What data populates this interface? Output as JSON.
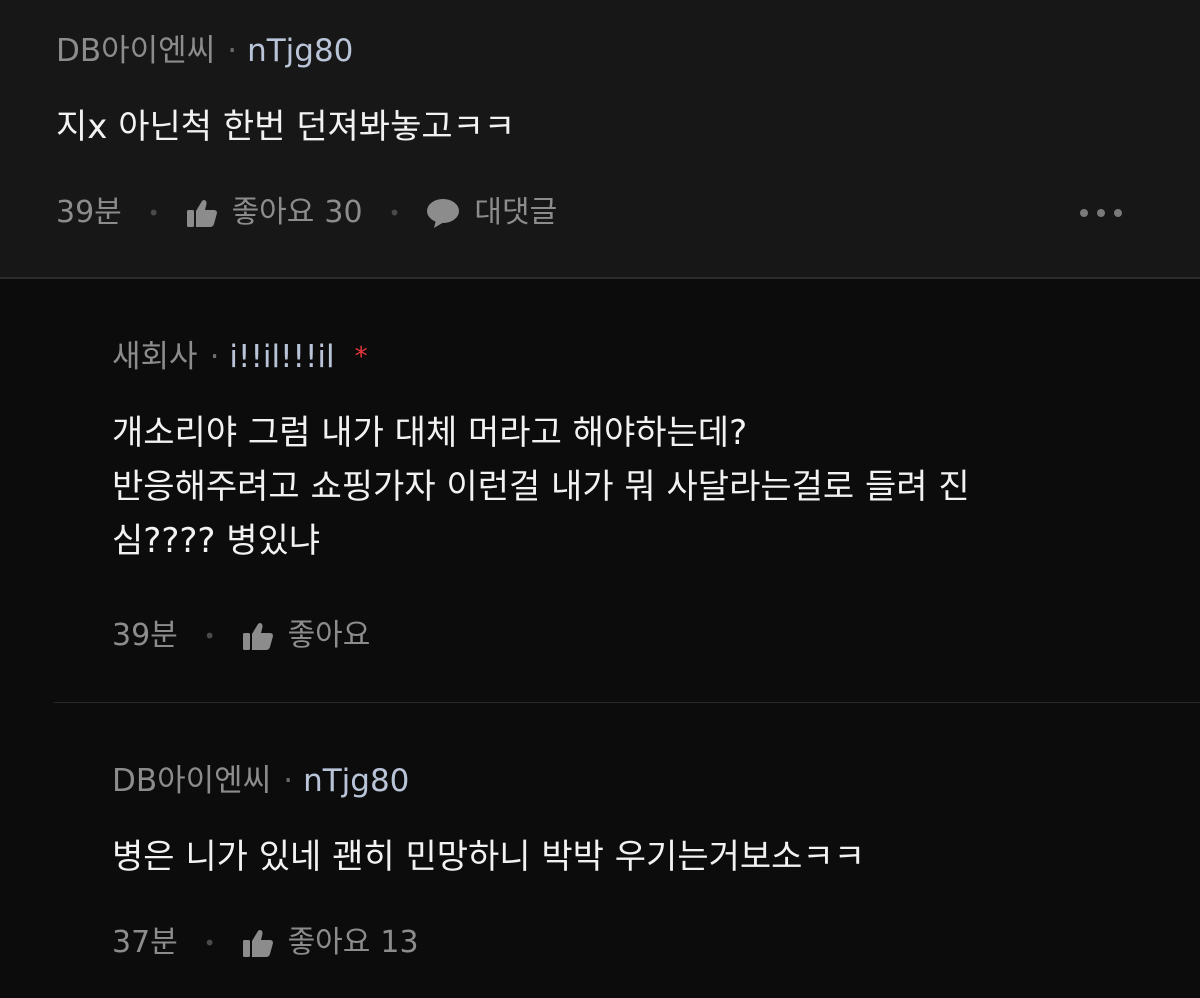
{
  "comments": [
    {
      "author": "DB아이엔씨",
      "separator": "·",
      "user_id": "nTjg80",
      "text": [
        "지x 아닌척 한번 던져봐놓고ㅋㅋ"
      ],
      "time": "39분",
      "like_label": "좋아요",
      "like_count": "30",
      "reply_label": "대댓글"
    }
  ],
  "replies": [
    {
      "author": "새회사",
      "separator": "·",
      "user_id": "i!!il!!!il",
      "badge": "*",
      "text": [
        "개소리야 그럼 내가 대체 머라고 해야하는데?",
        "반응해주려고 쇼핑가자 이런걸 내가 뭐 사달라는걸로 들려 진",
        "심???? 병있냐"
      ],
      "time": "39분",
      "like_label": "좋아요",
      "like_count": ""
    },
    {
      "author": "DB아이엔씨",
      "separator": "·",
      "user_id": "nTjg80",
      "text": [
        "병은 니가 있네 괜히 민망하니 박박 우기는거보소ㅋㅋ"
      ],
      "time": "37분",
      "like_label": "좋아요",
      "like_count": "13"
    }
  ],
  "icons": {
    "like": "thumbs-up-icon",
    "reply": "speech-bubble-icon",
    "more": "more-dots-icon"
  },
  "colors": {
    "background": "#0c0c0c",
    "top_comment_background": "#171717",
    "author": "#8c8c8c",
    "user_id": "#b9c4d9",
    "badge": "#e8383d",
    "text": "#f2f2f2"
  }
}
